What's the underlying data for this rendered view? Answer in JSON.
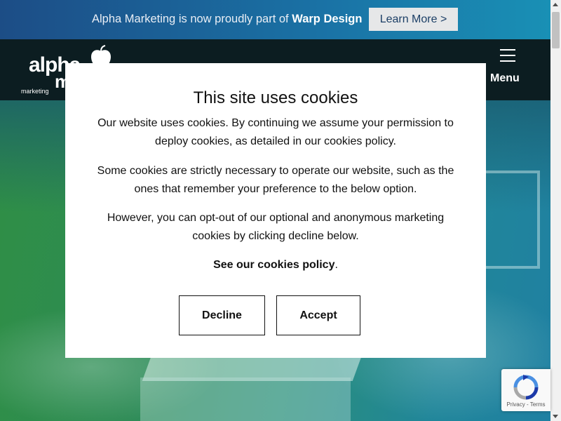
{
  "promo": {
    "text_prefix": "Alpha Marketing is now proudly part of ",
    "text_brand": "Warp Design",
    "button_label": "Learn More >"
  },
  "header": {
    "logo_word": "alpha",
    "logo_word_second": "m",
    "logo_tagline": "marketing",
    "menu_label": "Menu"
  },
  "cookie_modal": {
    "title": "This site uses cookies",
    "paragraph_1": "Our website uses cookies. By continuing we assume your permission to deploy cookies, as detailed in our cookies policy.",
    "paragraph_2": "Some cookies are strictly necessary to operate our website, such as the ones that remember your preference to the below option.",
    "paragraph_3": "However, you can opt-out of our optional and anonymous marketing cookies by clicking decline below.",
    "policy_link": "See our cookies policy",
    "policy_suffix": ".",
    "decline_label": "Decline",
    "accept_label": "Accept"
  },
  "recaptcha": {
    "privacy": "Privacy",
    "separator": " - ",
    "terms": "Terms"
  },
  "icons": {
    "hamburger": "hamburger-icon",
    "apple": "apple-icon",
    "recaptcha": "recaptcha-icon"
  },
  "colors": {
    "promo_bg": "#1a73a6",
    "header_bg": "#0c1d21",
    "hero_green": "#2f8f45",
    "hero_teal": "#1f80a2",
    "modal_bg": "#ffffff"
  }
}
